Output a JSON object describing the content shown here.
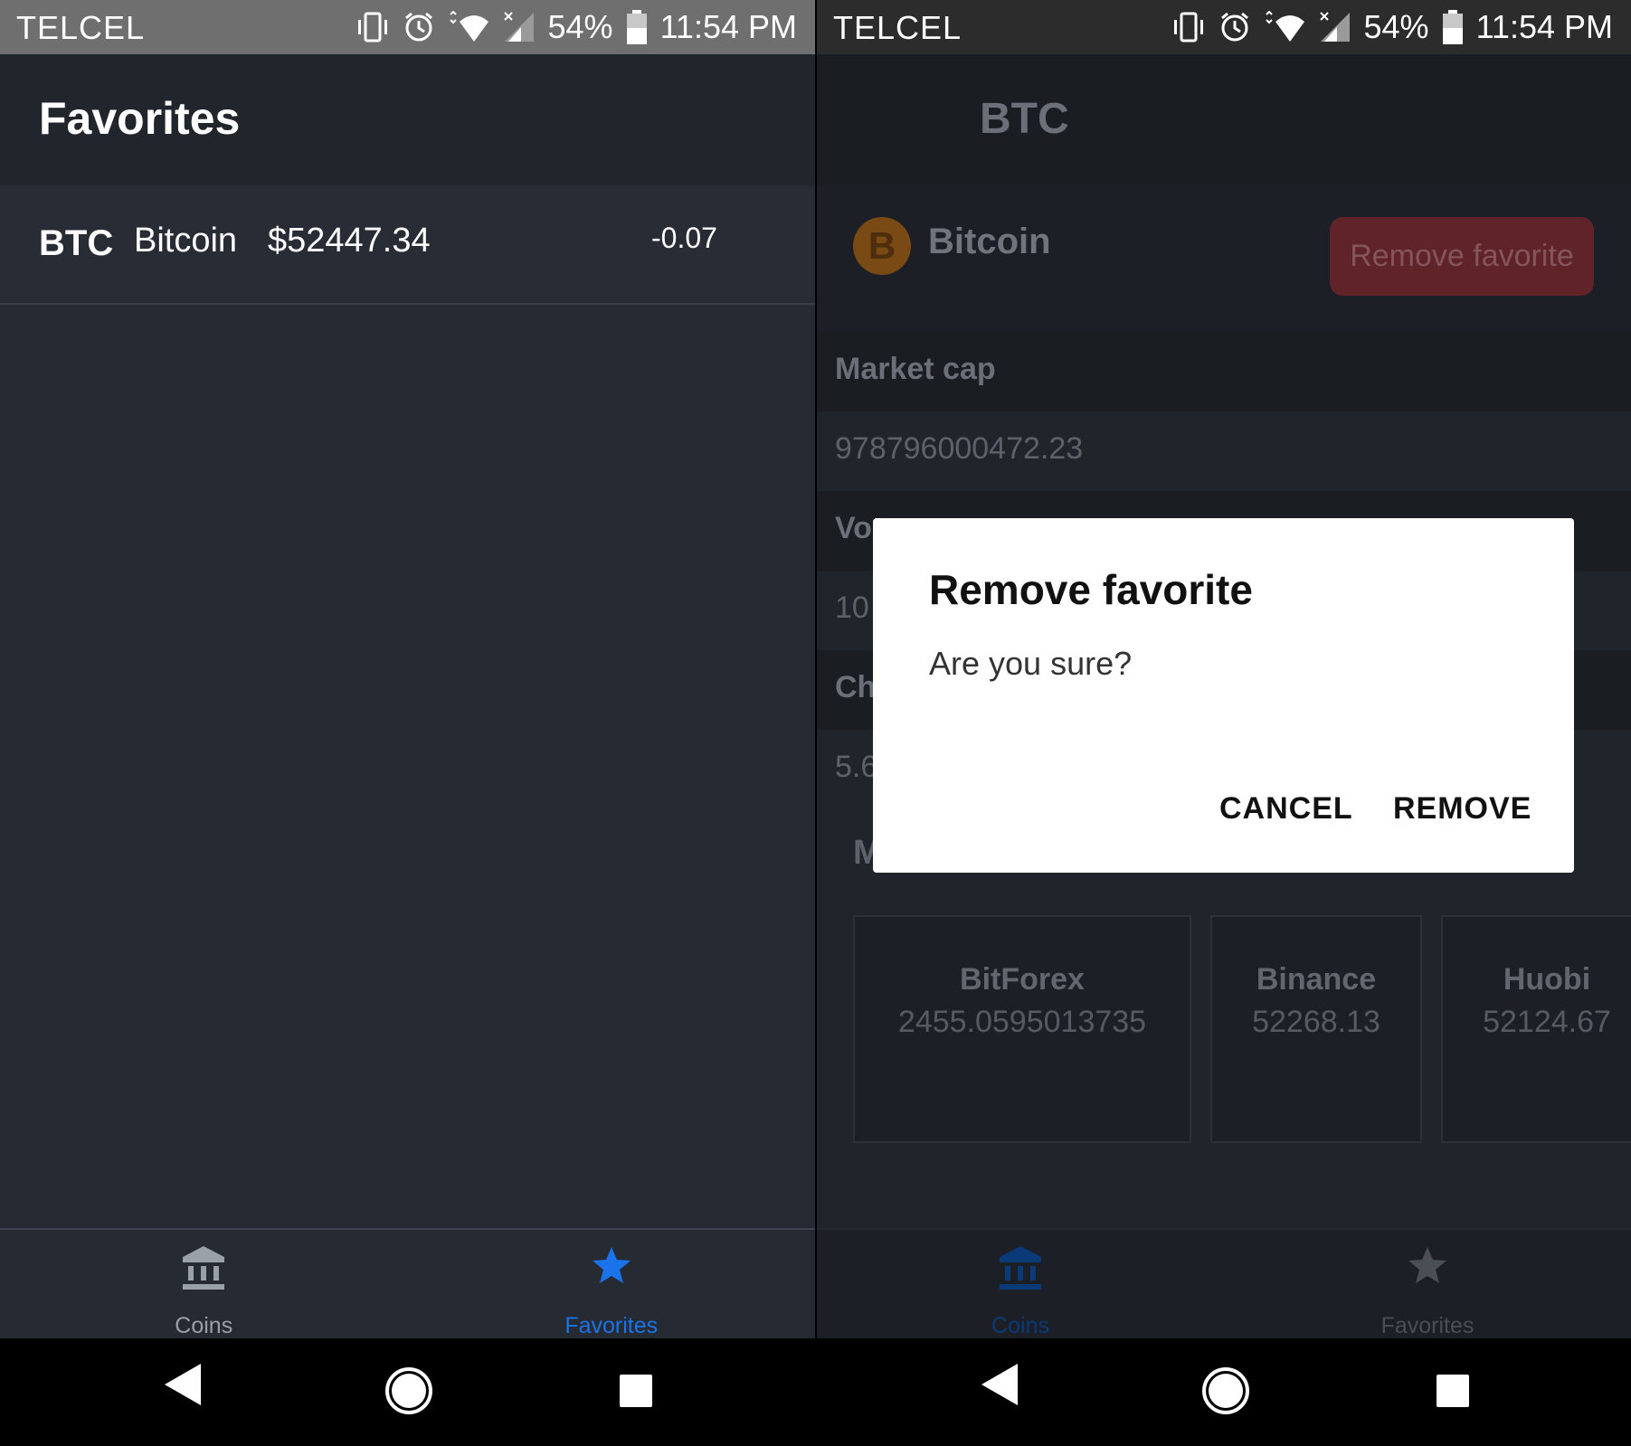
{
  "status": {
    "carrier": "TELCEL",
    "battery": "54%",
    "time": "11:54 PM"
  },
  "left": {
    "title": "Favorites",
    "favorites": [
      {
        "symbol": "BTC",
        "name": "Bitcoin",
        "price": "$52447.34",
        "change": "-0.07"
      }
    ],
    "tabs": [
      {
        "label": "Coins",
        "icon": "bank-icon",
        "active": false
      },
      {
        "label": "Favorites",
        "icon": "star-icon",
        "active": true
      }
    ]
  },
  "right": {
    "title": "BTC",
    "coin_name": "Bitcoin",
    "coin_logo_glyph": "B",
    "remove_button": "Remove favorite",
    "stats": [
      {
        "label": "Market cap",
        "value": "978796000472.23"
      },
      {
        "label": "Vo",
        "value": "10"
      },
      {
        "label": "Ch",
        "value": "5.6"
      }
    ],
    "markets_heading": "M",
    "markets": [
      {
        "name": "BitForex",
        "price": "2455.0595013735"
      },
      {
        "name": "Binance",
        "price": "52268.13"
      },
      {
        "name": "Huobi",
        "price": "52124.67"
      }
    ],
    "tabs": [
      {
        "label": "Coins",
        "icon": "bank-icon",
        "active": true
      },
      {
        "label": "Favorites",
        "icon": "star-icon",
        "active": false
      }
    ],
    "dialog": {
      "title": "Remove favorite",
      "message": "Are you sure?",
      "cancel": "CANCEL",
      "confirm": "REMOVE"
    }
  },
  "colors": {
    "accent": "#1a73e8",
    "inactive_tab": "#9aa0a8",
    "remove_button": "#5f2329"
  }
}
